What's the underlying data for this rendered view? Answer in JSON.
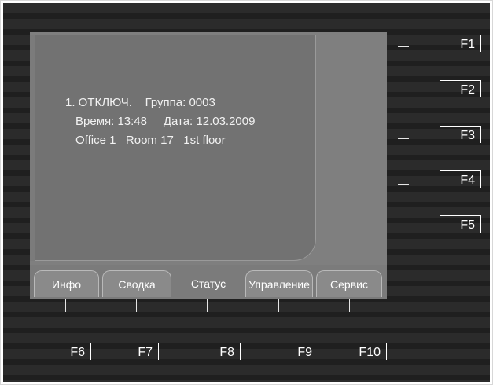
{
  "display": {
    "line1": "1. ОТКЛЮЧ.    Группа: 0003",
    "line2": "Время: 13:48     Дата: 12.03.2009",
    "line3": "Office 1   Room 17   1st floor"
  },
  "tabs": [
    {
      "label": "Инфо"
    },
    {
      "label": "Сводка"
    },
    {
      "label": "Статус"
    },
    {
      "label": "Управление"
    },
    {
      "label": "Сервис"
    }
  ],
  "side_keys": [
    "F1",
    "F2",
    "F3",
    "F4",
    "F5"
  ],
  "bottom_keys": [
    "F6",
    "F7",
    "F8",
    "F9",
    "F10"
  ],
  "active_tab": "Статус"
}
